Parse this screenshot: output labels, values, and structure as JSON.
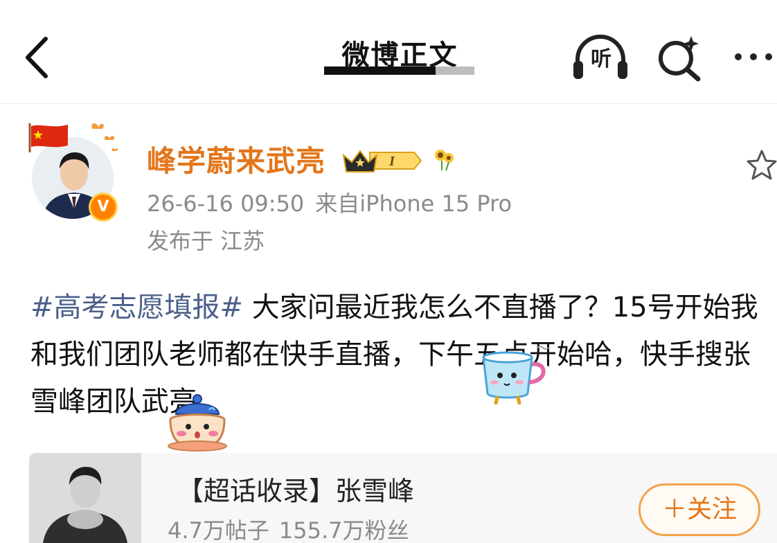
{
  "header": {
    "title": "微博正文",
    "listen_label": "听"
  },
  "author": {
    "name": "峰学蔚来武亮",
    "verified_mark": "V",
    "level_badge": "I",
    "timestamp": "26-6-16 09:50",
    "source": "来自iPhone 15 Pro",
    "location": "发布于 江苏"
  },
  "post": {
    "hashtag": "#高考志愿填报#",
    "body": " 大家问最近我怎么不直播了？15号开始我和我们团队老师都在快手直播，下午五点开始哈，快手搜张雪峰团队武亮。"
  },
  "topic_card": {
    "title": "【超话收录】张雪峰",
    "posts": "4.7万帖子",
    "fans": "155.7万粉丝",
    "follow_label": "＋关注"
  },
  "colors": {
    "author_name": "#e3761b",
    "hashtag": "#4a5f8a",
    "meta_text": "#8a8a8a",
    "follow_border": "#f3a24a",
    "verified_badge": "#ff8200"
  },
  "icons": {
    "back": "chevron-left-icon",
    "listen": "headphones-icon",
    "search": "search-sparkle-icon",
    "more": "more-dots-icon",
    "favorite": "star-outline-icon"
  }
}
